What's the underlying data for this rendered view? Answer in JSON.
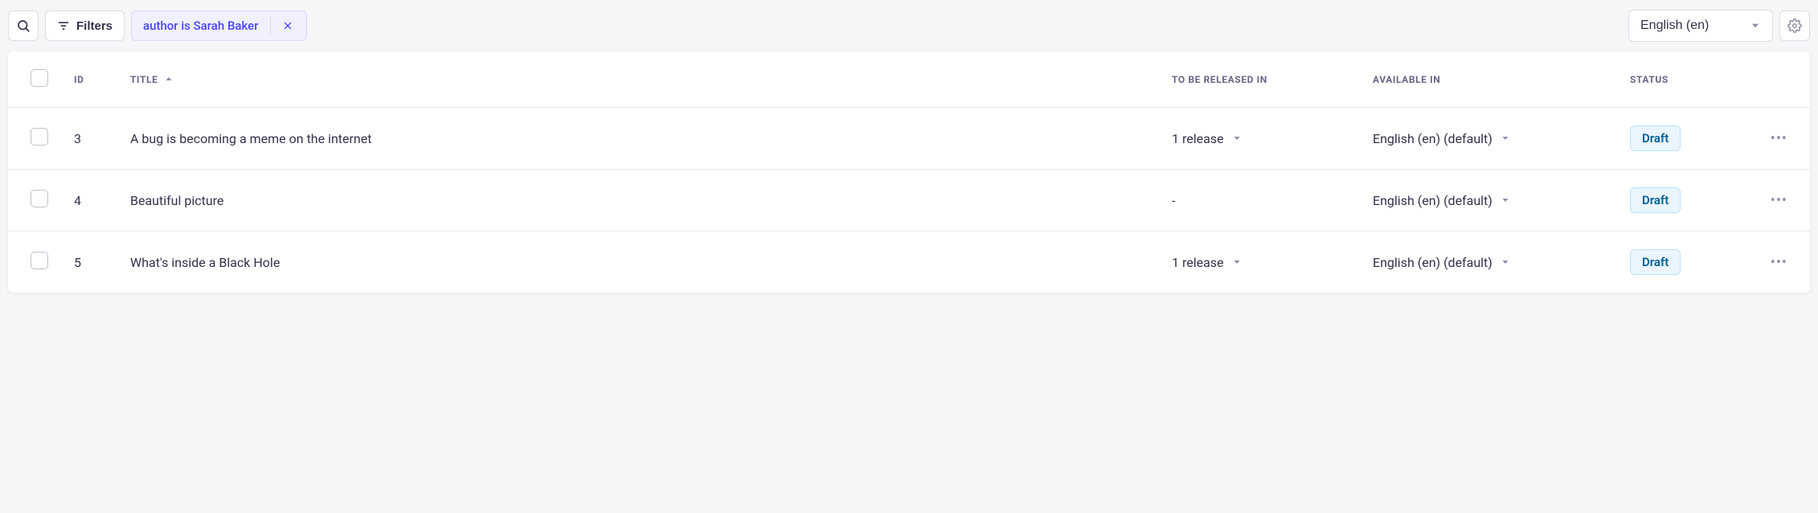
{
  "toolbar": {
    "filters_label": "Filters",
    "filter_chip_text": "author is Sarah Baker",
    "locale_label": "English (en)"
  },
  "columns": {
    "id": "ID",
    "title": "TITLE",
    "release": "TO BE RELEASED IN",
    "available": "AVAILABLE IN",
    "status": "STATUS"
  },
  "rows": [
    {
      "id": "3",
      "title": "A bug is becoming a meme on the internet",
      "release": "1 release",
      "has_release": true,
      "available": "English (en) (default)",
      "status": "Draft"
    },
    {
      "id": "4",
      "title": "Beautiful picture",
      "release": "-",
      "has_release": false,
      "available": "English (en) (default)",
      "status": "Draft"
    },
    {
      "id": "5",
      "title": "What's inside a Black Hole",
      "release": "1 release",
      "has_release": true,
      "available": "English (en) (default)",
      "status": "Draft"
    }
  ]
}
